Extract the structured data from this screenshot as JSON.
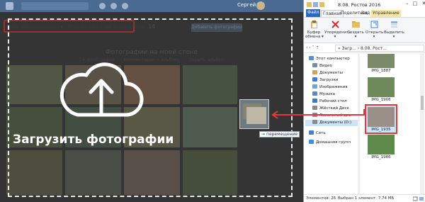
{
  "vk": {
    "user_name": "Сергей",
    "breadcrumb": {
      "root": "Мои фотографии",
      "separator": "›",
      "current": "Фотографии на моей стене",
      "count": "14"
    },
    "add_photos_label": "Добавить фотографии",
    "album_title": "Фотографии на моей стене",
    "album_meta": {
      "count": "14 фотографий",
      "comments": "Комментарии к альбому",
      "hide": "Скрыть альбом"
    },
    "drop_label": "Загрузить фотографии",
    "drag_move_tag": {
      "arrow": "→",
      "label": "перемещение"
    }
  },
  "explorer": {
    "title": "8.08. Ростов 2016",
    "window_buttons": [
      "–",
      "□",
      "✕"
    ],
    "tabs": {
      "file": "Файл",
      "home": "Главная",
      "share": "Поделиться",
      "view": "Вид",
      "manage": "Управление"
    },
    "ribbon": [
      {
        "label1": "Буфер",
        "label2": "обмена ▾",
        "icon": "clipboard-icon"
      },
      {
        "label1": "Упорядочить",
        "label2": "▾",
        "icon": "organize-icon"
      },
      {
        "label1": "Создать",
        "label2": "▾",
        "icon": "new-folder-icon"
      },
      {
        "label1": "Открыть",
        "label2": "▾",
        "icon": "open-icon"
      },
      {
        "label1": "Выделить",
        "label2": "▾",
        "icon": "select-icon"
      }
    ],
    "address": {
      "nav": "‹  ›  ˅  ↑",
      "path": "«  Загр...  ›  8.08. Рост..."
    },
    "nav_items": [
      {
        "label": "Этот компьютер",
        "icon": "computer-icon",
        "color": "#5b8fc9"
      },
      {
        "label": "Видео",
        "icon": "video-icon",
        "color": "#7a8da6"
      },
      {
        "label": "Документы",
        "icon": "documents-icon",
        "color": "#c9a94c"
      },
      {
        "label": "Загрузки",
        "icon": "downloads-icon",
        "color": "#3a7dd3"
      },
      {
        "label": "Изображения",
        "icon": "pictures-icon",
        "color": "#6aa6d6"
      },
      {
        "label": "Музыка",
        "icon": "music-icon",
        "color": "#5d86c4"
      },
      {
        "label": "Рабочий стол",
        "icon": "desktop-icon",
        "color": "#3b7bc9"
      },
      {
        "label": "Жёсткий Диск",
        "icon": "hdd-icon",
        "color": "#8a8a8a"
      },
      {
        "label": "Локальный дис",
        "icon": "local-disk-icon",
        "color": "#8a8a8a"
      },
      {
        "label": "Документы (D:)",
        "icon": "drive-d-icon",
        "color": "#8a8a8a"
      },
      {
        "label": "Сеть",
        "icon": "network-icon",
        "color": "#4a7fc6"
      },
      {
        "label": "Домашняя групп",
        "icon": "homegroup-icon",
        "color": "#3f8fd8"
      }
    ],
    "files": [
      {
        "name": "IMG_1887"
      },
      {
        "name": "IMG_1906"
      },
      {
        "name": "IMG_1935"
      },
      {
        "name": "IMG_1986"
      }
    ],
    "status": {
      "count": "Элементов: 26",
      "selected": "Выбран 1 элемент: 7,74 МБ"
    }
  }
}
